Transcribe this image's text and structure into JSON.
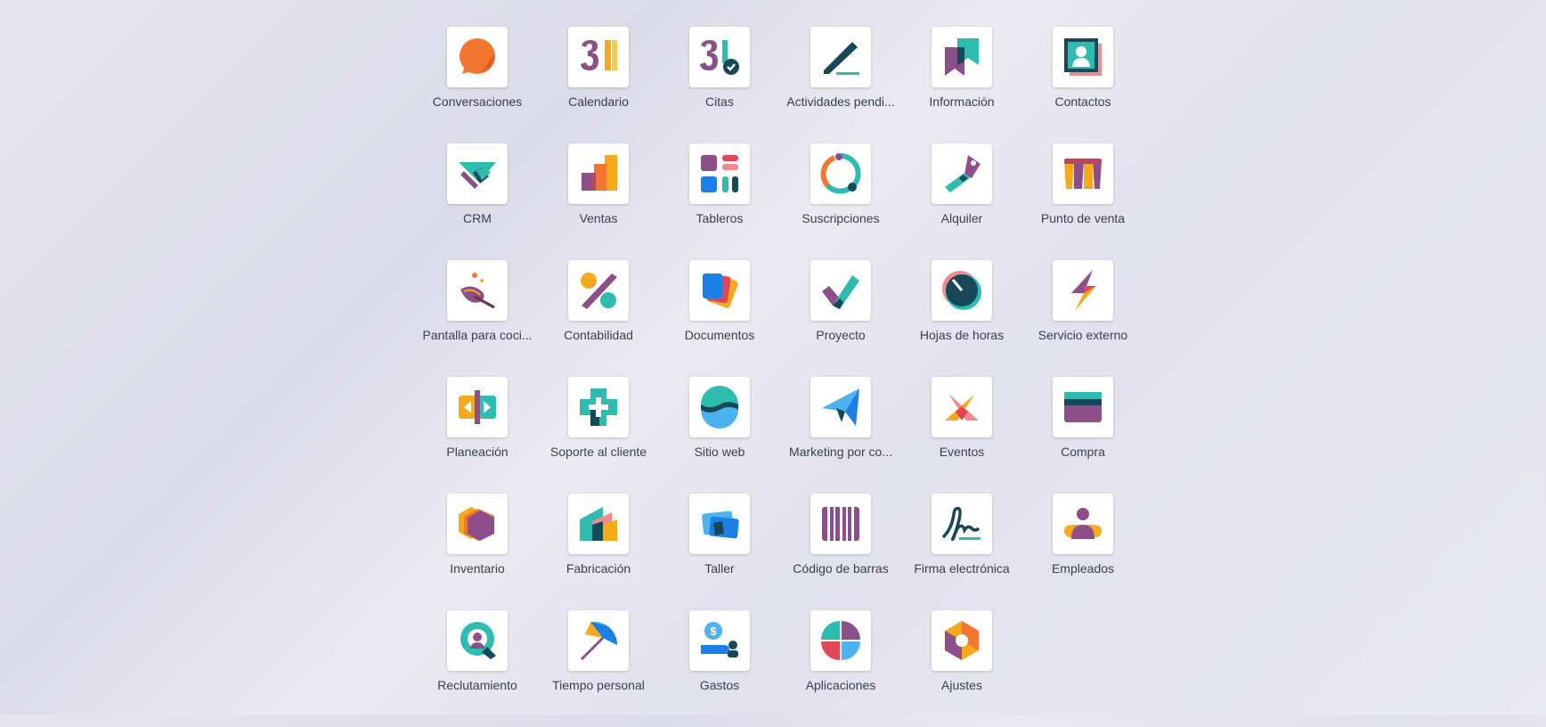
{
  "apps": [
    {
      "label": "Conversaciones",
      "icon": "chat-bubble-icon"
    },
    {
      "label": "Calendario",
      "icon": "calendar-icon"
    },
    {
      "label": "Citas",
      "icon": "appointment-icon"
    },
    {
      "label": "Actividades pendi...",
      "icon": "pen-icon"
    },
    {
      "label": "Información",
      "icon": "bookmark-icon"
    },
    {
      "label": "Contactos",
      "icon": "contact-card-icon"
    },
    {
      "label": "CRM",
      "icon": "handshake-icon"
    },
    {
      "label": "Ventas",
      "icon": "sales-chart-icon"
    },
    {
      "label": "Tableros",
      "icon": "dashboard-icon"
    },
    {
      "label": "Suscripciones",
      "icon": "recurring-icon"
    },
    {
      "label": "Alquiler",
      "icon": "key-icon"
    },
    {
      "label": "Punto de venta",
      "icon": "shop-awning-icon"
    },
    {
      "label": "Pantalla para coci...",
      "icon": "kitchen-icon"
    },
    {
      "label": "Contabilidad",
      "icon": "percent-icon"
    },
    {
      "label": "Documentos",
      "icon": "documents-icon"
    },
    {
      "label": "Proyecto",
      "icon": "check-icon"
    },
    {
      "label": "Hojas de horas",
      "icon": "timer-icon"
    },
    {
      "label": "Servicio externo",
      "icon": "lightning-icon"
    },
    {
      "label": "Planeación",
      "icon": "planning-icon"
    },
    {
      "label": "Soporte al cliente",
      "icon": "lifebuoy-icon"
    },
    {
      "label": "Sitio web",
      "icon": "globe-icon"
    },
    {
      "label": "Marketing por co...",
      "icon": "paper-plane-icon"
    },
    {
      "label": "Eventos",
      "icon": "event-icon"
    },
    {
      "label": "Compra",
      "icon": "credit-card-icon"
    },
    {
      "label": "Inventario",
      "icon": "box-icon"
    },
    {
      "label": "Fabricación",
      "icon": "factory-icon"
    },
    {
      "label": "Taller",
      "icon": "workshop-icon"
    },
    {
      "label": "Código de barras",
      "icon": "barcode-icon"
    },
    {
      "label": "Firma electrónica",
      "icon": "signature-icon"
    },
    {
      "label": "Empleados",
      "icon": "employees-icon"
    },
    {
      "label": "Reclutamiento",
      "icon": "recruitment-icon"
    },
    {
      "label": "Tiempo personal",
      "icon": "umbrella-icon"
    },
    {
      "label": "Gastos",
      "icon": "expenses-icon"
    },
    {
      "label": "Aplicaciones",
      "icon": "apps-icon"
    },
    {
      "label": "Ajustes",
      "icon": "settings-icon"
    }
  ]
}
